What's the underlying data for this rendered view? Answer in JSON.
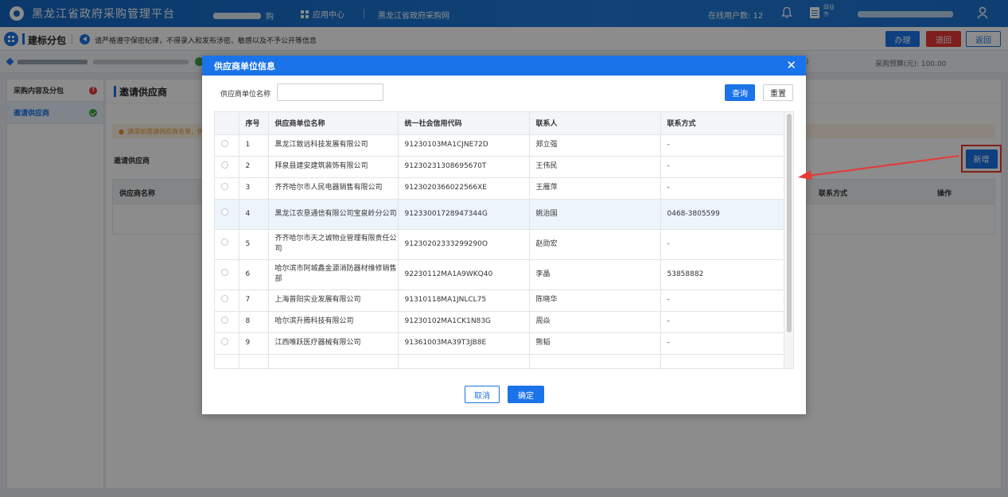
{
  "topbar": {
    "title": "黑龙江省政府采购管理平台",
    "region_suffix": "购",
    "app_center": "应用中心",
    "site_link": "黑龙江省政府采购网",
    "online_label": "在线用户数: 12",
    "user_line1": "邱业",
    "user_line2": "齐"
  },
  "subbar": {
    "title": "建标分包",
    "notice": "请严格遵守保密纪律，不得录入和发布涉密、敏感以及不予公开等信息",
    "btn_handle": "办理",
    "btn_return": "退回",
    "btn_back": "返回"
  },
  "infobar": {
    "budget": "采购预算(元): 100.00",
    "right_fragment": ")"
  },
  "leftnav": {
    "items": [
      {
        "label": "采购内容及分包",
        "status": "error"
      },
      {
        "label": "邀请供应商",
        "status": "ok"
      }
    ]
  },
  "content": {
    "title": "邀请供应商",
    "warning": "请添加邀请供应商名单，供",
    "invite_label": "邀请供应商",
    "add_button": "新增",
    "bg_columns": [
      "供应商名称",
      "联系方式",
      "操作"
    ]
  },
  "modal": {
    "title": "供应商单位信息",
    "close": "✕",
    "search_label": "供应商单位名称",
    "search_value": "",
    "search_placeholder": "",
    "btn_query": "查询",
    "btn_reset": "重置",
    "columns": [
      "序号",
      "供应商单位名称",
      "统一社会信用代码",
      "联系人",
      "联系方式"
    ],
    "rows": [
      {
        "no": "1",
        "name": "黑龙江致远科技发展有限公司",
        "code": "91230103MA1CJNE72D",
        "contact": "郑立强",
        "phone": "-"
      },
      {
        "no": "2",
        "name": "拜泉县建安建筑装饰有限公司",
        "code": "91230231308695670T",
        "contact": "王伟民",
        "phone": "-"
      },
      {
        "no": "3",
        "name": "齐齐哈尔市人民电器销售有限公司",
        "code": "9123020366022566XE",
        "contact": "王雁萍",
        "phone": "-"
      },
      {
        "no": "4",
        "name": "黑龙江农垦通信有限公司宝泉岭分公司",
        "code": "91233001728947344G",
        "contact": "姚治国",
        "phone": "0468-3805599"
      },
      {
        "no": "5",
        "name": "齐齐哈尔市天之诚物业管理有限责任公司",
        "code": "91230202333299290O",
        "contact": "赵勋宏",
        "phone": "-"
      },
      {
        "no": "6",
        "name": "哈尔滨市阿城鑫金源消防器材维修销售部",
        "code": "92230112MA1A9WKQ40",
        "contact": "李晶",
        "phone": "53858882"
      },
      {
        "no": "7",
        "name": "上海普阳实业发展有限公司",
        "code": "91310118MA1JNLCL75",
        "contact": "陈晓华",
        "phone": "-"
      },
      {
        "no": "8",
        "name": "哈尔滨升腾科技有限公司",
        "code": "91230102MA1CK1N83G",
        "contact": "周焱",
        "phone": "-"
      },
      {
        "no": "9",
        "name": "江西唯跃医疗器械有限公司",
        "code": "91361003MA39T3JB8E",
        "contact": "熊韬",
        "phone": "-"
      }
    ],
    "btn_cancel": "取消",
    "btn_ok": "确定"
  },
  "colors": {
    "primary": "#1a73e8",
    "danger": "#e53935",
    "topbar": "#1f7ad8",
    "success": "#43a047",
    "warning": "#e6932c"
  }
}
